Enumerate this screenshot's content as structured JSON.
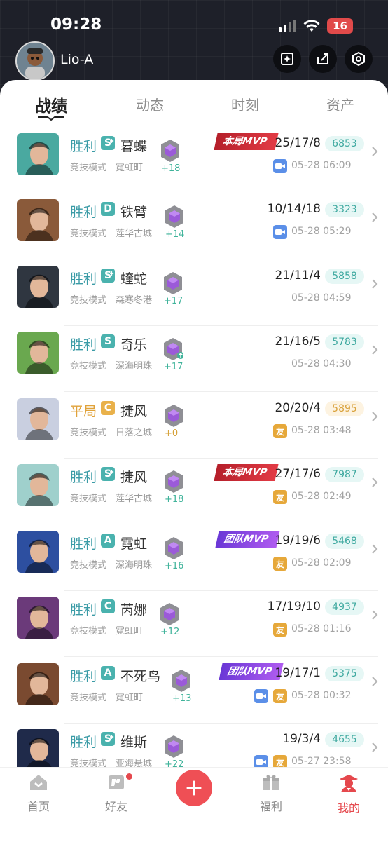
{
  "status_bar": {
    "time": "09:28",
    "battery": "16"
  },
  "profile": {
    "username": "Lio-A"
  },
  "tabs": [
    {
      "label": "战绩"
    },
    {
      "label": "动态"
    },
    {
      "label": "时刻"
    },
    {
      "label": "资产"
    }
  ],
  "matches": [
    {
      "result": "胜利",
      "rank": "S",
      "rank_plus": true,
      "agent": "暮蝶",
      "mode": "竞技模式｜霓虹町",
      "delta": "+18",
      "kda": "25/17/8",
      "score": "6853",
      "score_style": "green",
      "mvp": "本局MVP",
      "mvp_type": "match",
      "badges": [
        "video"
      ],
      "time": "05-28 06:09",
      "hero_color": "#4aa9a0"
    },
    {
      "result": "胜利",
      "rank": "D",
      "rank_plus": false,
      "agent": "铁臂",
      "mode": "竞技模式｜莲华古城",
      "delta": "+14",
      "kda": "10/14/18",
      "score": "3323",
      "score_style": "green",
      "mvp": "",
      "mvp_type": "",
      "badges": [
        "video"
      ],
      "time": "05-28 05:29",
      "hero_color": "#8a5a3a"
    },
    {
      "result": "胜利",
      "rank": "S",
      "rank_plus": true,
      "agent": "蝰蛇",
      "mode": "竞技模式｜森寒冬港",
      "delta": "+17",
      "kda": "21/11/4",
      "score": "5858",
      "score_style": "green",
      "mvp": "",
      "mvp_type": "",
      "badges": [],
      "time": "05-28 04:59",
      "hero_color": "#2f3640"
    },
    {
      "result": "胜利",
      "rank": "S",
      "rank_plus": false,
      "agent": "奇乐",
      "mode": "竞技模式｜深海明珠",
      "delta": "+17",
      "kda": "21/16/5",
      "score": "5783",
      "score_style": "green",
      "mvp": "",
      "mvp_type": "",
      "badges": [],
      "time": "05-28 04:30",
      "hero_color": "#6aa84f",
      "gem_up": true
    },
    {
      "result": "平局",
      "rank": "C",
      "rank_plus": false,
      "agent": "捷风",
      "mode": "竞技模式｜日落之城",
      "delta": "+0",
      "kda": "20/20/4",
      "score": "5895",
      "score_style": "yellow",
      "mvp": "",
      "mvp_type": "",
      "badges": [
        "friend"
      ],
      "time": "05-28 03:48",
      "hero_color": "#c9cfe0"
    },
    {
      "result": "胜利",
      "rank": "S",
      "rank_plus": true,
      "agent": "捷风",
      "mode": "竞技模式｜莲华古城",
      "delta": "+18",
      "kda": "27/17/6",
      "score": "7987",
      "score_style": "green",
      "mvp": "本局MVP",
      "mvp_type": "match",
      "badges": [
        "friend"
      ],
      "time": "05-28 02:49",
      "hero_color": "#9fd0cc"
    },
    {
      "result": "胜利",
      "rank": "A",
      "rank_plus": false,
      "agent": "霓虹",
      "mode": "竞技模式｜深海明珠",
      "delta": "+16",
      "kda": "19/19/6",
      "score": "5468",
      "score_style": "green",
      "mvp": "团队MVP",
      "mvp_type": "team",
      "badges": [
        "friend"
      ],
      "time": "05-28 02:09",
      "hero_color": "#2d4fa0"
    },
    {
      "result": "胜利",
      "rank": "C",
      "rank_plus": false,
      "agent": "芮娜",
      "mode": "竞技模式｜霓虹町",
      "delta": "+12",
      "kda": "17/19/10",
      "score": "4937",
      "score_style": "green",
      "mvp": "",
      "mvp_type": "",
      "badges": [
        "friend"
      ],
      "time": "05-28 01:16",
      "hero_color": "#6b3a7a"
    },
    {
      "result": "胜利",
      "rank": "A",
      "rank_plus": false,
      "agent": "不死鸟",
      "mode": "竞技模式｜霓虹町",
      "delta": "+13",
      "kda": "19/17/1",
      "score": "5375",
      "score_style": "green",
      "mvp": "团队MVP",
      "mvp_type": "team",
      "badges": [
        "video",
        "friend"
      ],
      "time": "05-28 00:32",
      "hero_color": "#7a4a30"
    },
    {
      "result": "胜利",
      "rank": "S",
      "rank_plus": true,
      "agent": "维斯",
      "mode": "竞技模式｜亚海悬城",
      "delta": "+22",
      "kda": "19/3/4",
      "score": "4655",
      "score_style": "green",
      "mvp": "",
      "mvp_type": "",
      "badges": [
        "video",
        "friend"
      ],
      "time": "05-27 23:58",
      "hero_color": "#1f2a4a"
    }
  ],
  "friend_badge": "友",
  "bottom_nav": [
    {
      "label": "首页",
      "icon": "home-icon"
    },
    {
      "label": "好友",
      "icon": "friends-icon"
    },
    {
      "label": "",
      "icon": "plus-icon"
    },
    {
      "label": "福利",
      "icon": "gift-icon"
    },
    {
      "label": "我的",
      "icon": "profile-icon"
    }
  ],
  "colors": {
    "win": "#3a9ba6",
    "draw": "#e0a23a",
    "accent": "#ef4f55",
    "mvp_match": "#d3323c",
    "mvp_team": "#8b4be8"
  }
}
